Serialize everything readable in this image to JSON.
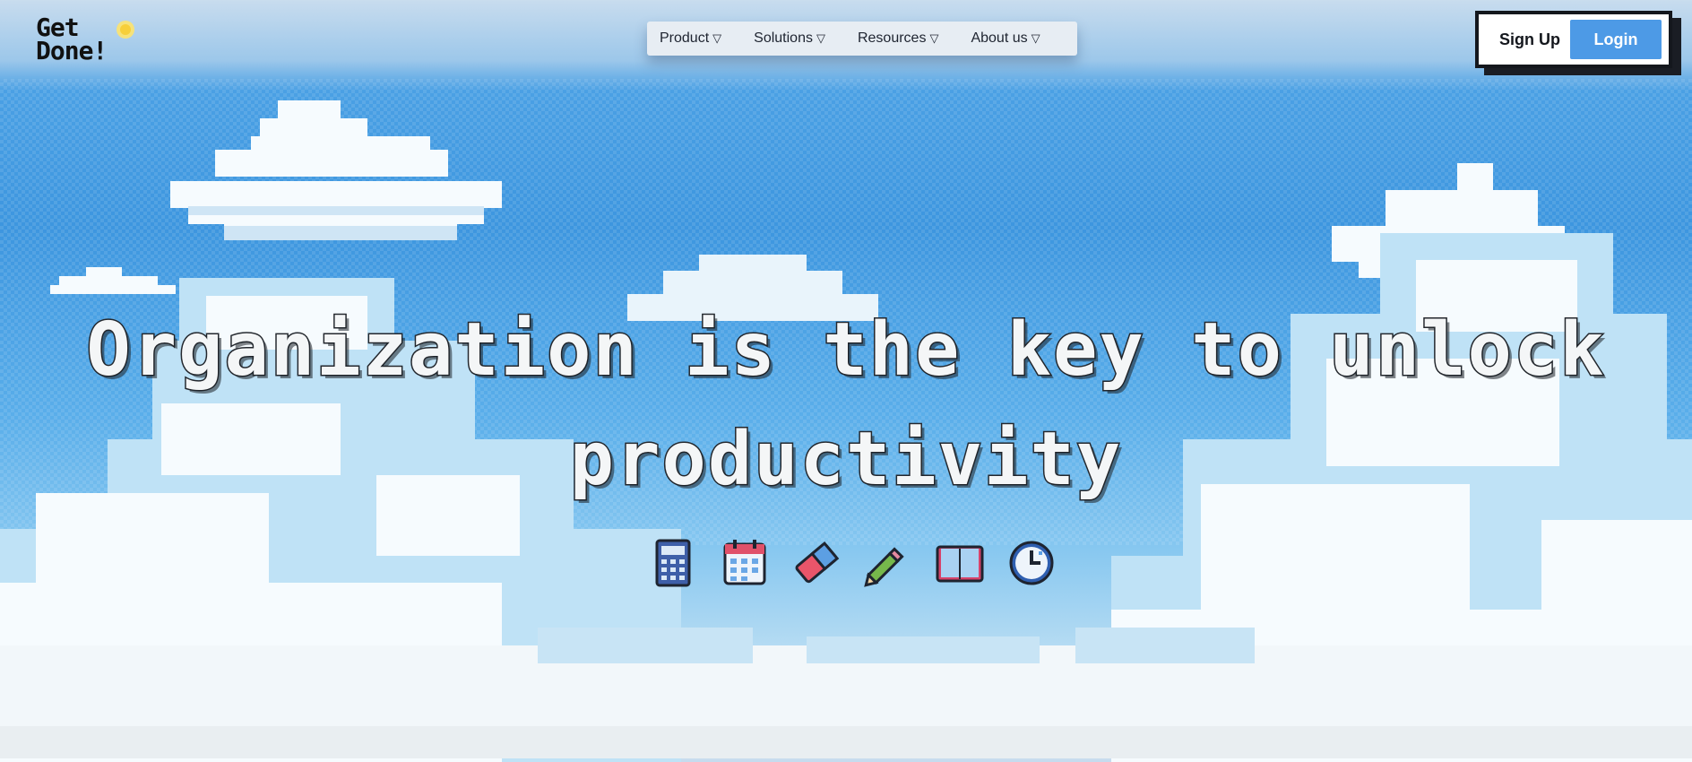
{
  "brand": {
    "logo_line1": "Get",
    "logo_line2": "Done!",
    "icon": "sun-icon"
  },
  "nav": {
    "items": [
      {
        "label": "Product",
        "icon": "chevron-down-icon"
      },
      {
        "label": "Solutions",
        "icon": "chevron-down-icon"
      },
      {
        "label": "Resources",
        "icon": "chevron-down-icon"
      },
      {
        "label": "About us",
        "icon": "chevron-down-icon"
      }
    ],
    "caret_glyph": "▽"
  },
  "auth": {
    "signup_label": "Sign Up",
    "login_label": "Login"
  },
  "hero": {
    "headline_line1": "Organization is the key to unlock",
    "headline_line2": "productivity"
  },
  "tools": [
    {
      "icon": "calculator-icon"
    },
    {
      "icon": "calendar-icon"
    },
    {
      "icon": "eraser-icon"
    },
    {
      "icon": "pencil-icon"
    },
    {
      "icon": "book-icon"
    },
    {
      "icon": "clock-icon"
    }
  ],
  "colors": {
    "sky": "#3d96df",
    "cloud": "#f4f9fc",
    "login_button": "#4d9ae6",
    "border": "#14171d"
  }
}
